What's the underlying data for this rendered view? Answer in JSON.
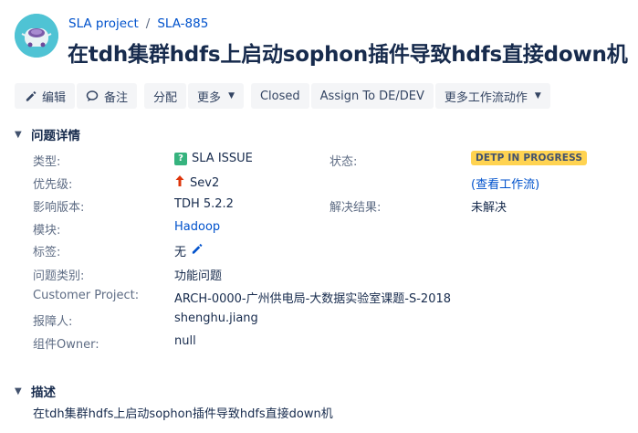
{
  "header": {
    "breadcrumb_project": "SLA project",
    "breadcrumb_sep": "/",
    "breadcrumb_issue": "SLA-885",
    "title": "在tdh集群hdfs上启动sophon插件导致hdfs直接down机"
  },
  "toolbar": {
    "edit_label": "编辑",
    "comment_label": "备注",
    "assign_label": "分配",
    "more_label": "更多",
    "closed_label": "Closed",
    "assign_to_label": "Assign To DE/DEV",
    "workflow_label": "更多工作流动作"
  },
  "details": {
    "section_title": "问题详情",
    "type_label": "类型:",
    "type_value": "SLA ISSUE",
    "priority_label": "优先级:",
    "priority_value": "Sev2",
    "affects_label": "影响版本:",
    "affects_value": "TDH 5.2.2",
    "component_label": "模块:",
    "component_value": "Hadoop",
    "labels_label": "标签:",
    "labels_value": "无",
    "category_label": "问题类别:",
    "category_value": "功能问题",
    "customer_label": "Customer Project:",
    "customer_value": "ARCH-0000-广州供电局-大数据实验室课题-S-2018",
    "reporter_label": "报障人:",
    "reporter_value": "shenghu.jiang",
    "owner_label": "组件Owner:",
    "owner_value": "null",
    "status_label": "状态:",
    "status_value": "DETP IN PROGRESS",
    "workflow_link": "(查看工作流)",
    "resolution_label": "解决结果:",
    "resolution_value": "未解决"
  },
  "description": {
    "section_title": "描述",
    "text": "在tdh集群hdfs上启动sophon插件导致hdfs直接down机"
  },
  "colors": {
    "link": "#0052cc",
    "status_bg": "#ffd351",
    "type_icon": "#36b37e",
    "priority_arrow": "#de350b",
    "avatar_bg": "#4fc3d4"
  }
}
